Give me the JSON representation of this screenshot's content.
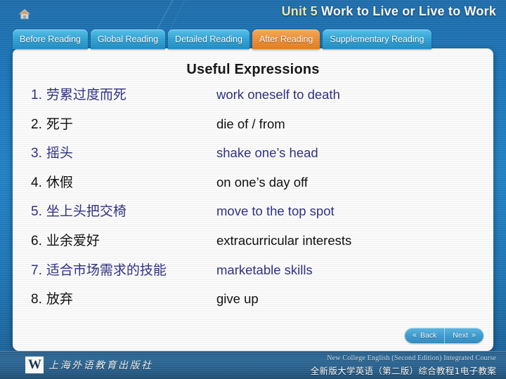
{
  "header": {
    "home_icon": "home-icon",
    "unit_number": "Unit 5",
    "unit_title": "Work to Live or Live to Work"
  },
  "tabs": [
    {
      "label": "Before Reading",
      "active": false
    },
    {
      "label": "Global Reading",
      "active": false
    },
    {
      "label": "Detailed Reading",
      "active": false
    },
    {
      "label": "After Reading",
      "active": true
    },
    {
      "label": "Supplementary Reading",
      "active": false
    }
  ],
  "main": {
    "title": "Useful Expressions",
    "rows": [
      {
        "num": "1.",
        "cn": "劳累过度而死",
        "en": "work oneself to death",
        "color": "blue"
      },
      {
        "num": "2.",
        "cn": "死于",
        "en": "die of / from",
        "color": "black"
      },
      {
        "num": "3.",
        "cn": "摇头",
        "en": "shake one’s head",
        "color": "blue"
      },
      {
        "num": "4.",
        "cn": "休假",
        "en": "on one’s day off",
        "color": "black"
      },
      {
        "num": "5.",
        "cn": "坐上头把交椅",
        "en": "move to the top spot",
        "color": "blue"
      },
      {
        "num": "6.",
        "cn": "业余爱好",
        "en": "extracurricular interests",
        "color": "black"
      },
      {
        "num": "7.",
        "cn": "适合市场需求的技能",
        "en": "marketable skills",
        "color": "blue"
      },
      {
        "num": "8.",
        "cn": "放弃",
        "en": "give up",
        "color": "black"
      }
    ]
  },
  "nav": {
    "back_label": "Back",
    "next_label": "Next",
    "back_icon": "«",
    "next_icon": "»"
  },
  "footer": {
    "publisher_mark": "W",
    "publisher_name": "上海外语教育出版社",
    "course_en": "New College English (Second Edition) Integrated Course",
    "course_cn": "全新版大学英语（第二版）综合教程1电子教案"
  },
  "colors": {
    "accent_blue": "#2e2f86",
    "tab_active": "#e8801f",
    "tab_inactive": "#34a8db",
    "title_highlight": "#f2edb0",
    "background": "#2285c8"
  }
}
